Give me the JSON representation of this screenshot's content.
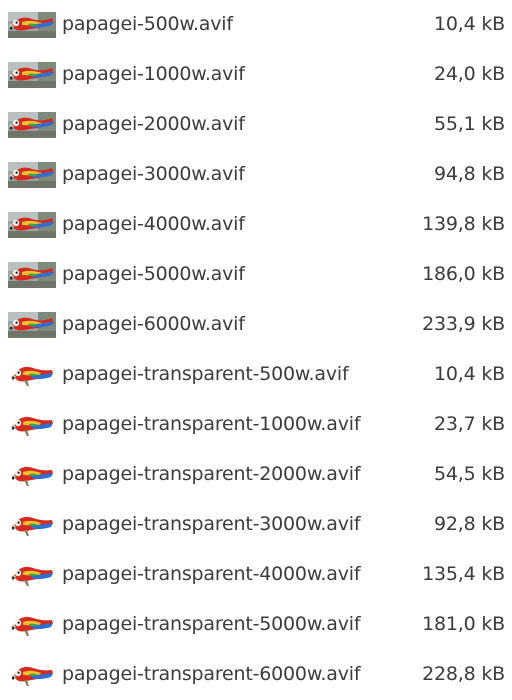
{
  "files": [
    {
      "name": "papagei-500w.avif",
      "size": "10,4 kB",
      "thumb": "photo"
    },
    {
      "name": "papagei-1000w.avif",
      "size": "24,0 kB",
      "thumb": "photo"
    },
    {
      "name": "papagei-2000w.avif",
      "size": "55,1 kB",
      "thumb": "photo"
    },
    {
      "name": "papagei-3000w.avif",
      "size": "94,8 kB",
      "thumb": "photo"
    },
    {
      "name": "papagei-4000w.avif",
      "size": "139,8 kB",
      "thumb": "photo"
    },
    {
      "name": "papagei-5000w.avif",
      "size": "186,0 kB",
      "thumb": "photo"
    },
    {
      "name": "papagei-6000w.avif",
      "size": "233,9 kB",
      "thumb": "photo"
    },
    {
      "name": "papagei-transparent-500w.avif",
      "size": "10,4 kB",
      "thumb": "transparent"
    },
    {
      "name": "papagei-transparent-1000w.avif",
      "size": "23,7 kB",
      "thumb": "transparent"
    },
    {
      "name": "papagei-transparent-2000w.avif",
      "size": "54,5 kB",
      "thumb": "transparent"
    },
    {
      "name": "papagei-transparent-3000w.avif",
      "size": "92,8 kB",
      "thumb": "transparent"
    },
    {
      "name": "papagei-transparent-4000w.avif",
      "size": "135,4 kB",
      "thumb": "transparent"
    },
    {
      "name": "papagei-transparent-5000w.avif",
      "size": "181,0 kB",
      "thumb": "transparent"
    },
    {
      "name": "papagei-transparent-6000w.avif",
      "size": "228,8 kB",
      "thumb": "transparent"
    }
  ]
}
